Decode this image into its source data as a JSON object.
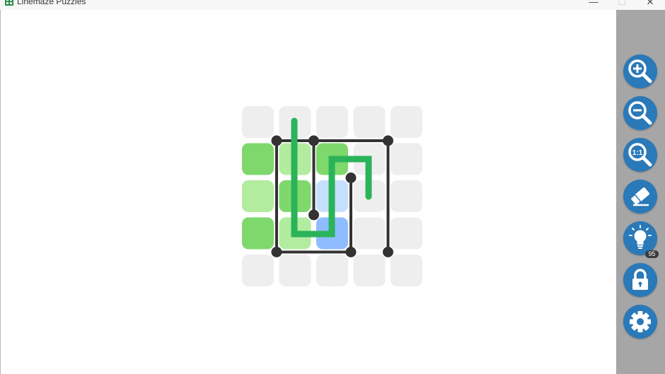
{
  "window": {
    "title": "Linemaze Puzzles",
    "minimize_glyph": "—",
    "maximize_glyph": "☐",
    "close_glyph": "✕"
  },
  "toolbar": {
    "buttons": [
      {
        "name": "zoom-in-button",
        "icon": "zoom-in-icon"
      },
      {
        "name": "zoom-out-button",
        "icon": "zoom-out-icon"
      },
      {
        "name": "zoom-reset-button",
        "icon": "zoom-reset-icon",
        "label": "1:1"
      },
      {
        "name": "eraser-button",
        "icon": "eraser-icon"
      },
      {
        "name": "hint-button",
        "icon": "lightbulb-icon"
      },
      {
        "name": "lock-button",
        "icon": "lock-icon"
      },
      {
        "name": "settings-button",
        "icon": "gear-icon"
      }
    ],
    "hint_count": "95"
  },
  "puzzle": {
    "rows": 5,
    "cols": 5,
    "cell_colors": [
      [
        "empty",
        "empty",
        "empty",
        "empty",
        "empty"
      ],
      [
        "green",
        "light-green",
        "green",
        "empty",
        "empty"
      ],
      [
        "light-green",
        "green",
        "light-blue",
        "empty",
        "empty"
      ],
      [
        "green",
        "light-green",
        "blue",
        "empty",
        "empty"
      ],
      [
        "empty",
        "empty",
        "empty",
        "empty",
        "empty"
      ]
    ],
    "palette": {
      "empty": "#eeeeee",
      "green": "#7fd86c",
      "light-green": "#b2ec9f",
      "light-blue": "#c6dfff",
      "blue": "#8ebcff",
      "path": "#2bb35a",
      "wall": "#333333",
      "toolbar_button": "#2a79b8"
    }
  }
}
